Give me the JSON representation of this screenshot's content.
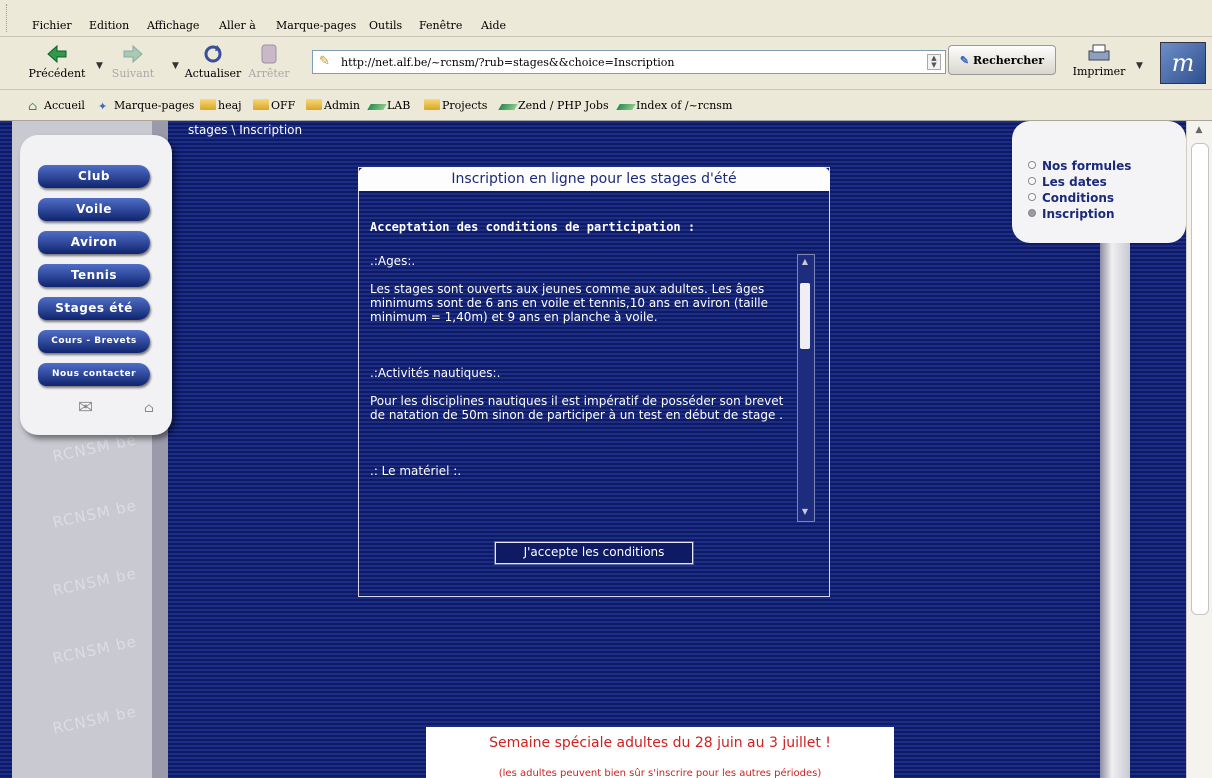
{
  "menubar": {
    "items": [
      "Fichier",
      "Edition",
      "Affichage",
      "Aller à",
      "Marque-pages",
      "Outils",
      "Fenêtre",
      "Aide"
    ]
  },
  "toolbar": {
    "back_label": "Précédent",
    "forward_label": "Suivant",
    "reload_label": "Actualiser",
    "stop_label": "Arrêter",
    "url": "http://net.alf.be/~rcnsm/?rub=stages&&choice=Inscription",
    "search_label": "Rechercher",
    "print_label": "Imprimer"
  },
  "bookmarks": {
    "items": [
      {
        "label": "Accueil",
        "icon": "home-icon"
      },
      {
        "label": "Marque-pages",
        "icon": "bookmarks-icon"
      },
      {
        "label": "heaj",
        "icon": "folder-icon"
      },
      {
        "label": "OFF",
        "icon": "folder-icon"
      },
      {
        "label": "Admin",
        "icon": "folder-icon"
      },
      {
        "label": "LAB",
        "icon": "link-icon"
      },
      {
        "label": "Projects",
        "icon": "folder-icon"
      },
      {
        "label": "Zend / PHP Jobs",
        "icon": "link-icon"
      },
      {
        "label": "Index of /~rcnsm",
        "icon": "link-icon"
      }
    ]
  },
  "site": {
    "breadcrumb": "stages \\ Inscription",
    "watermark": "RCNSM be",
    "nav": [
      "Club",
      "Voile",
      "Aviron",
      "Tennis",
      "Stages été",
      "Cours - Brevets",
      "Nous contacter"
    ],
    "submenu": [
      "Nos formules",
      "Les dates",
      "Conditions",
      "Inscription"
    ],
    "panel": {
      "title": "Inscription en ligne pour les stages d'été",
      "subtitle": "Acceptation des conditions de participation :",
      "sections": [
        {
          "heading": ".:Ages:.",
          "body": "Les stages sont ouverts aux jeunes comme aux adultes. Les âges minimums sont de 6 ans en voile et tennis,10 ans en aviron (taille minimum = 1,40m) et 9 ans en planche à voile."
        },
        {
          "heading": ".:Activités nautiques:.",
          "body": "Pour les disciplines nautiques il est impératif de posséder son brevet de natation de 50m sinon de participer à un test en début de stage ."
        },
        {
          "heading": ".: Le matériel :.",
          "body": ""
        }
      ],
      "accept_label": "J'accepte les conditions"
    },
    "promo": {
      "line1": "Semaine spéciale adultes du 28 juin au 3 juillet !",
      "line2": "(les adultes peuvent bien sûr s'inscrire pour les autres périodes)"
    }
  },
  "colors": {
    "page_bg": "#1c2d86",
    "nav_button": "#1c3590",
    "promo_text": "#d02020",
    "submenu_text": "#1c2a7c"
  }
}
